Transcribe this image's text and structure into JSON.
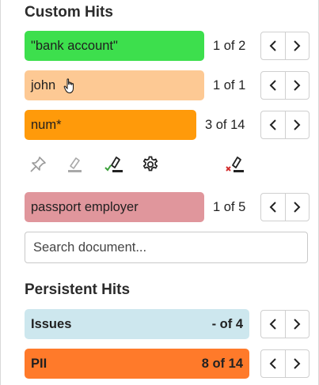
{
  "custom_hits": {
    "title": "Custom Hits",
    "items": [
      {
        "term": "\"bank account\"",
        "count": "1 of 2",
        "color": "#3ddf4d"
      },
      {
        "term": "john",
        "count": "1 of 1",
        "color": "#fdc994"
      },
      {
        "term": "num*",
        "count": "3 of 14",
        "color": "#ff9a0a"
      },
      {
        "term": "passport employer",
        "count": "1 of 5",
        "color": "#e0969c"
      }
    ]
  },
  "toolbar": {
    "icons": [
      "pin-icon",
      "highlighter-disabled-icon",
      "highlighter-check-icon",
      "gear-icon",
      "highlighter-remove-icon"
    ]
  },
  "search": {
    "placeholder": "Search document..."
  },
  "persistent_hits": {
    "title": "Persistent Hits",
    "items": [
      {
        "term": "Issues",
        "count": "- of 4",
        "color": "#cde7ee"
      },
      {
        "term": "PII",
        "count": "8 of 14",
        "color": "#ff7a2a"
      }
    ]
  },
  "colors": {
    "nav_border": "#cfcfcf",
    "text": "#222222"
  }
}
